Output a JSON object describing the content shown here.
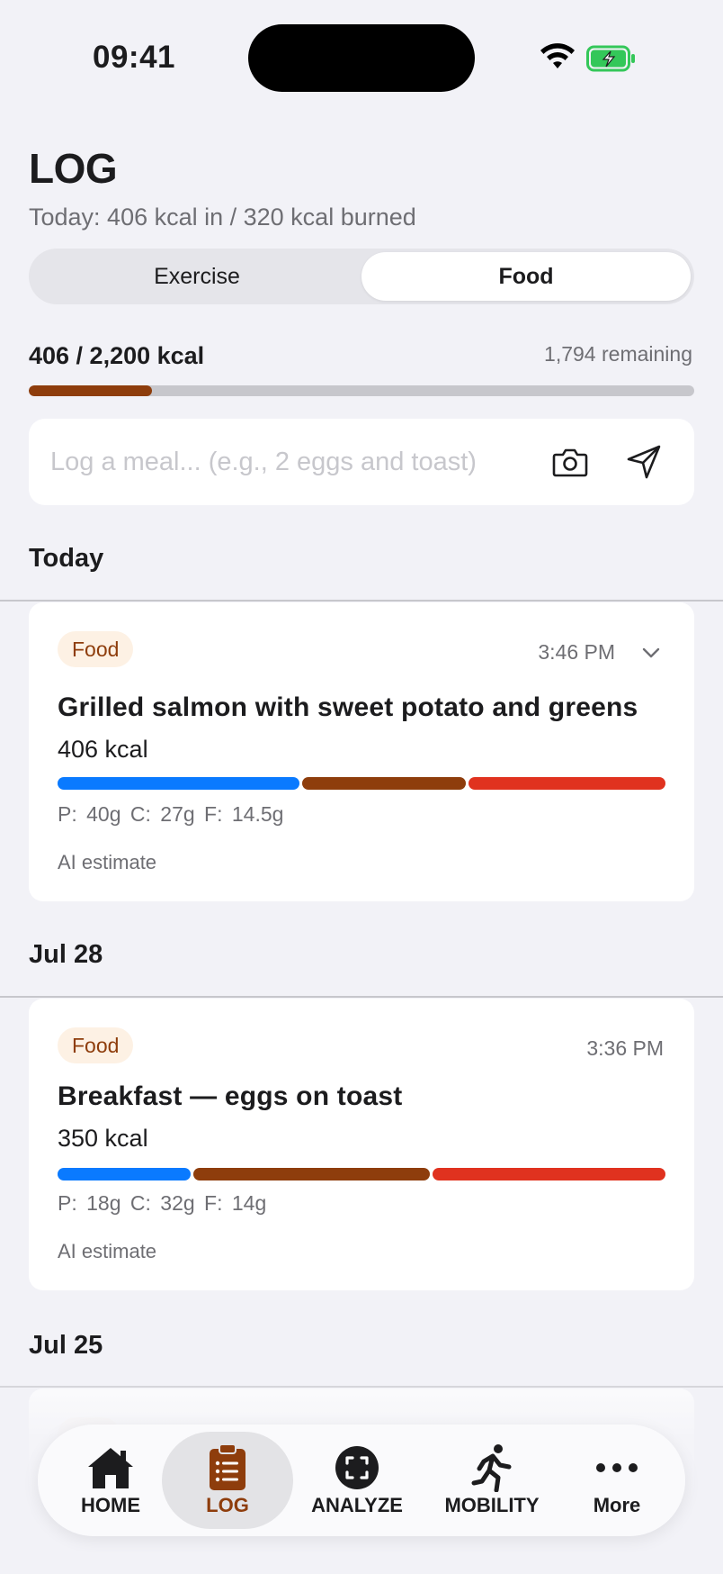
{
  "status_bar": {
    "time": "09:41"
  },
  "header": {
    "title": "LOG",
    "subtitle": "Today: 406 kcal in / 320 kcal burned"
  },
  "segmented": {
    "options": [
      {
        "label": "Exercise",
        "selected": false
      },
      {
        "label": "Food",
        "selected": true
      }
    ]
  },
  "calories": {
    "total_label": "406 / 2,200 kcal",
    "remaining_label": "1,794 remaining",
    "consumed": 406,
    "goal": 2200
  },
  "meal_input": {
    "value": "",
    "placeholder": "Log a meal... (e.g., 2 eggs and toast)"
  },
  "sections": [
    {
      "date": "Today",
      "entries": [
        {
          "tag": "Food",
          "time": "3:46 PM",
          "title": "Grilled salmon with sweet potato and greens",
          "kcal": "406 kcal",
          "macros_text": "P: 40g  C: 27g  F: 14.5g",
          "macros": {
            "protein_g": 40,
            "carbs_g": 27,
            "fat_g": 14.5
          },
          "source": "AI estimate"
        }
      ]
    },
    {
      "date": "Jul 28",
      "entries": [
        {
          "tag": "Food",
          "time": "3:36 PM",
          "title": "Breakfast — eggs on toast",
          "kcal": "350 kcal",
          "macros_text": "P: 18g  C: 32g  F: 14g",
          "macros": {
            "protein_g": 18,
            "carbs_g": 32,
            "fat_g": 14
          },
          "source": "AI estimate"
        }
      ]
    },
    {
      "date": "Jul 25"
    }
  ],
  "tab_bar": {
    "items": [
      {
        "label": "HOME",
        "icon": "home-icon",
        "active": false
      },
      {
        "label": "LOG",
        "icon": "clipboard-icon",
        "active": true
      },
      {
        "label": "ANALYZE",
        "icon": "scan-icon",
        "active": false
      },
      {
        "label": "MOBILITY",
        "icon": "runner-icon",
        "active": false
      },
      {
        "label": "More",
        "icon": "more-icon",
        "active": false
      }
    ]
  },
  "colors": {
    "accent": "#8e3d0c",
    "protein": "#0a7aff",
    "carbs": "#8e3d0c",
    "fat": "#e0321f",
    "tag_bg": "#fdf1e4",
    "background": "#f2f2f7"
  }
}
